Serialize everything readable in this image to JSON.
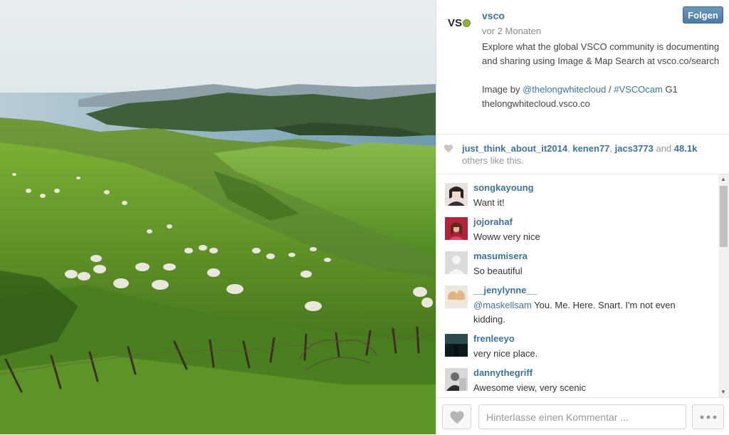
{
  "post": {
    "owner": {
      "username": "vsco",
      "avatar_text": "VS",
      "time_ago": "vor 2 Monaten",
      "follow_label": "Folgen"
    },
    "caption": {
      "line1": "Explore what the global VSCO community is documenting and sharing using Image & Map Search at vsco.co/search",
      "prefix": "Image by ",
      "mention": "@thelongwhitecloud",
      "separator": " / ",
      "hashtag": "#VSCOcam",
      "suffix": " G1",
      "line3": "thelongwhitecloud.vsco.co"
    },
    "likes": {
      "user1": "just_think_about_it2014",
      "sep1": ", ",
      "user2": "kenen77",
      "sep2": ", ",
      "user3": "jacs3773",
      "and_text": " and ",
      "count": "48.1k",
      "suffix": " others like this."
    }
  },
  "comments": [
    {
      "username": "songkayoung",
      "text": "Want it!"
    },
    {
      "username": "jojorahaf",
      "text": "Woww very nice"
    },
    {
      "username": "masumisera",
      "text": "So beautiful"
    },
    {
      "username": "__jenylynne__",
      "mention": "@maskellsam",
      "text": " You. Me. Here. Snart. I'm not even kidding."
    },
    {
      "username": "frenleeyo",
      "text": "very nice place."
    },
    {
      "username": "dannythegriff",
      "text": "Awesome view, very scenic"
    }
  ],
  "comment_box": {
    "placeholder": "Hinterlasse einen Kommentar ..."
  },
  "icons": {
    "like": "heart-icon",
    "more": "more-dots-icon"
  },
  "colors": {
    "link": "#3f729b",
    "follow_button": "#517fa4"
  }
}
